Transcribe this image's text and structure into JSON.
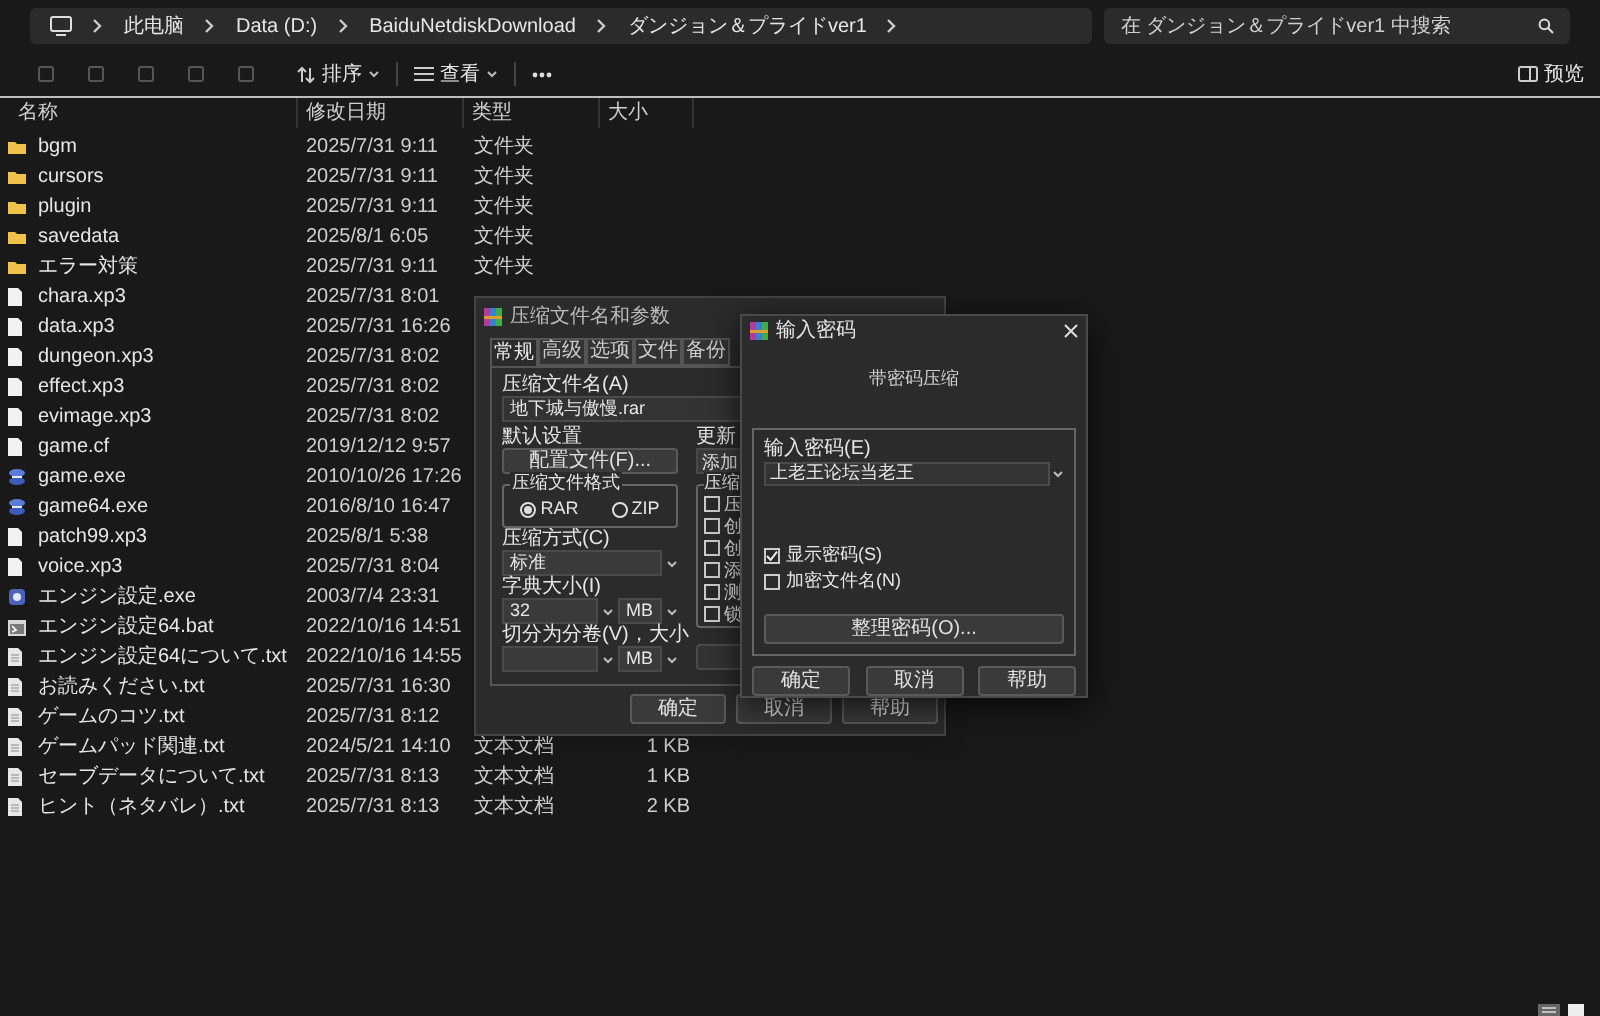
{
  "address_bar": {
    "path": [
      "此电脑",
      "Data (D:)",
      "BaiduNetdiskDownload",
      "ダンジョン＆プライドver1"
    ]
  },
  "search": {
    "placeholder": "在 ダンジョン＆プライドver1 中搜索"
  },
  "toolbar": {
    "sort": "排序",
    "view": "查看",
    "preview": "预览"
  },
  "columns": [
    "名称",
    "修改日期",
    "类型",
    "大小"
  ],
  "files": [
    {
      "kind": "folder",
      "name": "bgm",
      "modified": "2025/7/31 9:11",
      "type": "文件夹"
    },
    {
      "kind": "folder",
      "name": "cursors",
      "modified": "2025/7/31 9:11",
      "type": "文件夹"
    },
    {
      "kind": "folder",
      "name": "plugin",
      "modified": "2025/7/31 9:11",
      "type": "文件夹"
    },
    {
      "kind": "folder",
      "name": "savedata",
      "modified": "2025/8/1 6:05",
      "type": "文件夹"
    },
    {
      "kind": "folder",
      "name": "エラー対策",
      "modified": "2025/7/31 9:11",
      "type": "文件夹"
    },
    {
      "kind": "file",
      "name": "chara.xp3",
      "modified": "2025/7/31 8:01"
    },
    {
      "kind": "file",
      "name": "data.xp3",
      "modified": "2025/7/31 16:26"
    },
    {
      "kind": "file",
      "name": "dungeon.xp3",
      "modified": "2025/7/31 8:02"
    },
    {
      "kind": "file",
      "name": "effect.xp3",
      "modified": "2025/7/31 8:02"
    },
    {
      "kind": "file",
      "name": "evimage.xp3",
      "modified": "2025/7/31 8:02"
    },
    {
      "kind": "file",
      "name": "game.cf",
      "modified": "2019/12/12 9:57"
    },
    {
      "kind": "exe",
      "name": "game.exe",
      "modified": "2010/10/26 17:26"
    },
    {
      "kind": "exe",
      "name": "game64.exe",
      "modified": "2016/8/10 16:47"
    },
    {
      "kind": "file",
      "name": "patch99.xp3",
      "modified": "2025/8/1 5:38"
    },
    {
      "kind": "file",
      "name": "voice.xp3",
      "modified": "2025/7/31 8:04"
    },
    {
      "kind": "setup",
      "name": "エンジン設定.exe",
      "modified": "2003/7/4 23:31"
    },
    {
      "kind": "bat",
      "name": "エンジン設定64.bat",
      "modified": "2022/10/16 14:51"
    },
    {
      "kind": "text",
      "name": "エンジン設定64について.txt",
      "modified": "2022/10/16 14:55"
    },
    {
      "kind": "text",
      "name": "お読みください.txt",
      "modified": "2025/7/31 16:30"
    },
    {
      "kind": "text",
      "name": "ゲームのコツ.txt",
      "modified": "2025/7/31 8:12"
    },
    {
      "kind": "text",
      "name": "ゲームパッド関連.txt",
      "modified": "2024/5/21 14:10",
      "type": "文本文档",
      "size": "1 KB"
    },
    {
      "kind": "text",
      "name": "セーブデータについて.txt",
      "modified": "2025/7/31 8:13",
      "type": "文本文档",
      "size": "1 KB"
    },
    {
      "kind": "text",
      "name": "ヒント（ネタバレ）.txt",
      "modified": "2025/7/31 8:13",
      "type": "文本文档",
      "size": "2 KB"
    }
  ],
  "compress_dialog": {
    "title": "压缩文件名和参数",
    "tabs": [
      {
        "label": "常规",
        "selected": true
      },
      {
        "label": "高级",
        "selected": false
      },
      {
        "label": "选项",
        "selected": false
      },
      {
        "label": "文件",
        "selected": false
      },
      {
        "label": "备份",
        "selected": false
      }
    ],
    "archive_name_label": "压缩文件名(A)",
    "archive_name": "地下城与傲慢.rar",
    "default_label": "默认设置",
    "profiles_button": "配置文件(F)...",
    "update_label": "更新",
    "update_value": "添加",
    "format_group": "压缩文件格式",
    "formats": [
      {
        "label": "RAR",
        "selected": true
      },
      {
        "label": "ZIP",
        "selected": false
      }
    ],
    "method_label": "压缩方式(C)",
    "method": "标准",
    "dict_label": "字典大小(I)",
    "dict": "32",
    "dict_unit": "MB",
    "split_label": "切分为分卷(V)，大小",
    "split_unit": "MB",
    "options_group": "压缩",
    "options": [
      {
        "label": "压",
        "checked": false
      },
      {
        "label": "创",
        "checked": false
      },
      {
        "label": "创",
        "checked": false
      },
      {
        "label": "添",
        "checked": false
      },
      {
        "label": "测",
        "checked": false
      },
      {
        "label": "锁",
        "checked": false
      }
    ],
    "buttons": [
      "确定",
      "取消",
      "帮助"
    ]
  },
  "password_dialog": {
    "title": "输入密码",
    "subtitle": "带密码压缩",
    "password_label": "输入密码(E)",
    "password": "上老王论坛当老王",
    "options": [
      {
        "label": "显示密码(S)",
        "checked": true
      },
      {
        "label": "加密文件名(N)",
        "checked": false
      }
    ],
    "organize_button": "整理密码(O)...",
    "buttons": [
      "确定",
      "取消",
      "帮助"
    ]
  }
}
